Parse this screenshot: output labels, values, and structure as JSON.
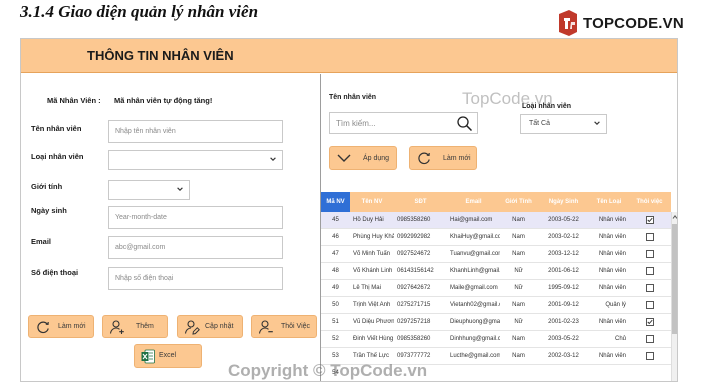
{
  "doc_heading": "3.1.4 Giao diện quản lý nhân viên",
  "logo_text": "TOPCODE.VN",
  "header": {
    "title": "THÔNG TIN NHÂN VIÊN"
  },
  "form": {
    "id_label": "Mã Nhân Viên :",
    "id_value": "Mã nhân viên tự động tăng!",
    "name_label": "Tên nhân viên",
    "name_placeholder": "Nhập tên nhân viên",
    "type_label": "Loại nhân viên",
    "type_value": "",
    "gender_label": "Giới tính",
    "gender_value": "",
    "dob_label": "Ngày sinh",
    "dob_placeholder": "Year-month-date",
    "email_label": "Email",
    "email_placeholder": "abc@gmail.com",
    "phone_label": "Số điện thoại",
    "phone_placeholder": "Nhập số điện thoại"
  },
  "buttons": {
    "refresh": "Làm mới",
    "add": "Thêm",
    "update": "Cập nhật",
    "remove": "Thôi Việc",
    "excel": "Excel"
  },
  "filter": {
    "name_label": "Tên nhân viên",
    "search_placeholder": "Tìm kiếm...",
    "type_label": "Loại nhân viên",
    "type_value": "Tất Cả",
    "apply": "Áp dụng",
    "refresh": "Làm mới"
  },
  "table": {
    "headers": [
      "Mã NV",
      "Tên NV",
      "SĐT",
      "Email",
      "Giới Tính",
      "Ngày Sinh",
      "Tên Loại",
      "Thôi việc"
    ],
    "rows": [
      {
        "id": "45",
        "name": "Hồ Duy Hải",
        "phone": "0985358260",
        "email": "Hai@gmail.com",
        "gender": "Nam",
        "dob": "2003-05-22",
        "type": "Nhân viên",
        "resigned": true
      },
      {
        "id": "46",
        "name": "Phùng Huy Khải",
        "phone": "0992992982",
        "email": "KhaiHuy@gmail.com",
        "gender": "Nam",
        "dob": "2003-02-12",
        "type": "Nhân viên",
        "resigned": false
      },
      {
        "id": "47",
        "name": "Võ Minh Tuấn",
        "phone": "0927524672",
        "email": "Tuanvu@gmail.com",
        "gender": "Nam",
        "dob": "2003-12-12",
        "type": "Nhân viên",
        "resigned": false
      },
      {
        "id": "48",
        "name": "Võ Khánh Linh",
        "phone": "06143156142",
        "email": "KhanhLinh@gmail.com",
        "gender": "Nữ",
        "dob": "2001-06-12",
        "type": "Nhân viên",
        "resigned": false
      },
      {
        "id": "49",
        "name": "Lê Thị Mai",
        "phone": "0927642672",
        "email": "Maile@gmail.com",
        "gender": "Nữ",
        "dob": "1995-09-12",
        "type": "Nhân viên",
        "resigned": false
      },
      {
        "id": "50",
        "name": "Trịnh Việt Anh",
        "phone": "0275271715",
        "email": "Vietanh02@gmail.com",
        "gender": "Nam",
        "dob": "2001-09-12",
        "type": "Quản lý",
        "resigned": false
      },
      {
        "id": "51",
        "name": "Vũ Diệu Phương",
        "phone": "0297257218",
        "email": "Dieuphuong@gmail.c...",
        "gender": "Nữ",
        "dob": "2001-02-23",
        "type": "Nhân viên",
        "resigned": true
      },
      {
        "id": "52",
        "name": "Đinh Viết Hùng",
        "phone": "0985358260",
        "email": "Dinhhung@gmail.com",
        "gender": "Nam",
        "dob": "2003-05-22",
        "type": "Chủ",
        "resigned": false
      },
      {
        "id": "53",
        "name": "Trần Thế Lực",
        "phone": "0973777772",
        "email": "Lucthe@gmail.com",
        "gender": "Nam",
        "dob": "2002-03-12",
        "type": "Nhân viên",
        "resigned": false
      },
      {
        "id": "54",
        "name": "",
        "phone": "",
        "email": "",
        "gender": "",
        "dob": "",
        "type": "",
        "resigned": false
      }
    ]
  },
  "watermarks": {
    "center": "TopCode.vn",
    "bottom": "Copyright © TopCode.vn"
  },
  "colors": {
    "accent": "#fcc891",
    "header_cell": "#fcc891",
    "id_header_cell": "#2f6fd6",
    "selected_row": "#e8e7f7",
    "logo_red": "#c0392b"
  }
}
